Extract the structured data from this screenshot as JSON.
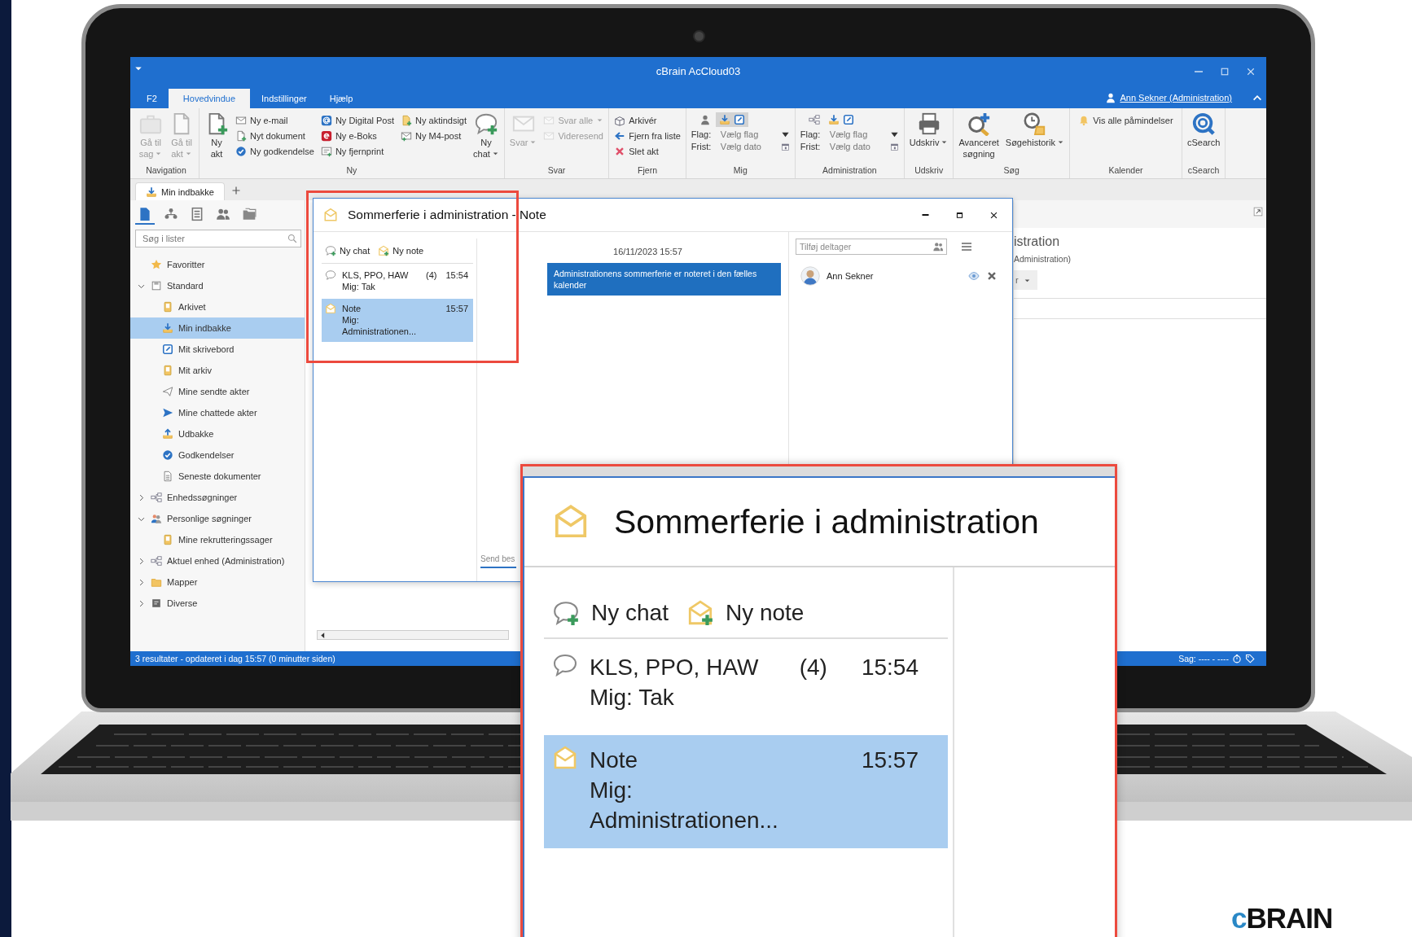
{
  "app_window": {
    "title": "cBrain AcCloud03",
    "user": "Ann Sekner (Administration)"
  },
  "ribbon_tabs": [
    {
      "label": "F2",
      "selected": false
    },
    {
      "label": "Hovedvindue",
      "selected": true
    },
    {
      "label": "Indstillinger",
      "selected": false
    },
    {
      "label": "Hjælp",
      "selected": false
    }
  ],
  "ribbon_groups": [
    {
      "label": "Navigation",
      "items": [
        {
          "kind": "large",
          "label": "Gå til\nsag",
          "dropdown": true,
          "disabled": true
        },
        {
          "kind": "large",
          "label": "Gå til\nakt",
          "dropdown": true,
          "disabled": true
        }
      ]
    },
    {
      "label": "Ny",
      "items": [
        {
          "kind": "large",
          "label": "Ny\nakt",
          "disabled": false
        },
        {
          "kind": "column",
          "entries": [
            {
              "label": "Ny e-mail",
              "disabled": false
            },
            {
              "label": "Nyt dokument",
              "disabled": false
            },
            {
              "label": "Ny godkendelse",
              "disabled": false
            }
          ]
        },
        {
          "kind": "column",
          "entries": [
            {
              "label": "Ny Digital Post",
              "disabled": false
            },
            {
              "label": "Ny e-Boks",
              "disabled": false
            },
            {
              "label": "Ny fjernprint",
              "disabled": false
            }
          ]
        },
        {
          "kind": "column",
          "entries": [
            {
              "label": "Ny aktindsigt",
              "disabled": false
            },
            {
              "label": "Ny M4-post",
              "disabled": false
            }
          ]
        },
        {
          "kind": "large",
          "label": "Ny\nchat",
          "dropdown": true,
          "disabled": false
        }
      ]
    },
    {
      "label": "Svar",
      "items": [
        {
          "kind": "large",
          "label": "Svar",
          "dropdown": true,
          "disabled": true
        },
        {
          "kind": "column",
          "entries": [
            {
              "label": "Svar alle",
              "dropdown": true,
              "disabled": true
            },
            {
              "label": "Videresend",
              "disabled": true
            }
          ]
        }
      ]
    },
    {
      "label": "Fjern",
      "items": [
        {
          "kind": "column",
          "entries": [
            {
              "label": "Arkivér",
              "disabled": false
            },
            {
              "label": "Fjern fra liste",
              "disabled": false
            },
            {
              "label": "Slet akt",
              "disabled": false
            }
          ]
        }
      ]
    },
    {
      "label": "Mig",
      "items": [
        {
          "kind": "flags",
          "toggled": true,
          "rows": [
            {
              "kind": "dropdown",
              "label": "Flag:",
              "value": "Vælg flag"
            },
            {
              "kind": "calendar",
              "label": "Frist:",
              "value": "Vælg dato"
            }
          ]
        }
      ]
    },
    {
      "label": "Administration",
      "items": [
        {
          "kind": "flags",
          "toggled": false,
          "rows": [
            {
              "kind": "dropdown",
              "label": "Flag:",
              "value": "Vælg flag"
            },
            {
              "kind": "calendar",
              "label": "Frist:",
              "value": "Vælg dato"
            }
          ]
        }
      ]
    },
    {
      "label": "Udskriv",
      "items": [
        {
          "kind": "large",
          "label": "Udskriv",
          "dropdown": true,
          "disabled": false
        }
      ]
    },
    {
      "label": "Søg",
      "items": [
        {
          "kind": "large",
          "label": "Avanceret\nsøgning",
          "disabled": false
        },
        {
          "kind": "large",
          "label": "Søgehistorik",
          "dropdown": true,
          "disabled": false
        }
      ]
    },
    {
      "label": "Kalender",
      "items": [
        {
          "kind": "column",
          "entries": [
            {
              "label": "Vis alle påmindelser",
              "disabled": false
            }
          ]
        }
      ]
    },
    {
      "label": "cSearch",
      "items": [
        {
          "kind": "large",
          "label": "cSearch",
          "disabled": false
        }
      ]
    }
  ],
  "document_tabs": [
    {
      "label": "Min indbakke",
      "selected": true
    }
  ],
  "sidebar": {
    "views": [
      {
        "selected": true
      },
      {
        "selected": false
      },
      {
        "selected": false
      },
      {
        "selected": false
      },
      {
        "selected": false
      }
    ],
    "search": {
      "placeholder": "Søg i lister"
    },
    "tree": [
      {
        "label": "Favoritter",
        "selected": false
      },
      {
        "label": "Standard",
        "selected": false,
        "expanded": true,
        "children": [
          {
            "label": "Arkivet",
            "selected": false
          },
          {
            "label": "Min indbakke",
            "selected": true
          },
          {
            "label": "Mit skrivebord",
            "selected": false
          },
          {
            "label": "Mit arkiv",
            "selected": false
          },
          {
            "label": "Mine sendte akter",
            "selected": false
          },
          {
            "label": "Mine chattede akter",
            "selected": false
          },
          {
            "label": "Udbakke",
            "selected": false
          },
          {
            "label": "Godkendelser",
            "selected": false
          },
          {
            "label": "Seneste dokumenter",
            "selected": false
          }
        ]
      },
      {
        "label": "Enhedssøgninger",
        "selected": false,
        "expanded": false
      },
      {
        "label": "Personlige søgninger",
        "selected": false,
        "expanded": true,
        "children": [
          {
            "label": "Mine rekrutteringssager",
            "selected": false
          }
        ]
      },
      {
        "label": "Aktuel enhed (Administration)",
        "selected": false,
        "expanded": false
      },
      {
        "label": "Mapper",
        "selected": false,
        "expanded": false
      },
      {
        "label": "Diverse",
        "selected": false,
        "expanded": false
      }
    ]
  },
  "reading_pane": {
    "heading": "istration",
    "subheading": "Administration)",
    "dropdown": "r"
  },
  "status_bar": {
    "text": "3 resultater - opdateret i dag 15:57 (0 minutter siden)",
    "case": "Sag: ---- - ----"
  },
  "note_window": {
    "title": "Sommerferie i administration - Note",
    "actions": [
      "Ny chat",
      "Ny note"
    ],
    "conversations": [
      {
        "kind": "chat",
        "title": "KLS, PPO, HAW",
        "count": "(4)",
        "time": "15:54",
        "preview": "Mig: Tak",
        "selected": false
      },
      {
        "kind": "note",
        "title": "Note",
        "time": "15:57",
        "preview": "Mig:\nAdministrationen...",
        "selected": true
      }
    ],
    "message_date": "16/11/2023 15:57",
    "message": "Administrationens sommerferie er noteret i den fælles kalender",
    "composer_placeholder": "Send bes",
    "participant_placeholder": "Tilføj deltager",
    "participants": [
      {
        "name": "Ann Sekner"
      }
    ]
  },
  "callout": {
    "title": "Sommerferie i administration",
    "actions": [
      "Ny chat",
      "Ny note"
    ],
    "conversations": [
      {
        "kind": "chat",
        "title": "KLS, PPO, HAW",
        "count": "(4)",
        "time": "15:54",
        "preview": "Mig: Tak",
        "selected": false
      },
      {
        "kind": "note",
        "title": "Note",
        "time": "15:57",
        "preview": "Mig:\nAdministrationen...",
        "selected": true
      }
    ]
  },
  "logo": {
    "text": "cBRAIN"
  }
}
